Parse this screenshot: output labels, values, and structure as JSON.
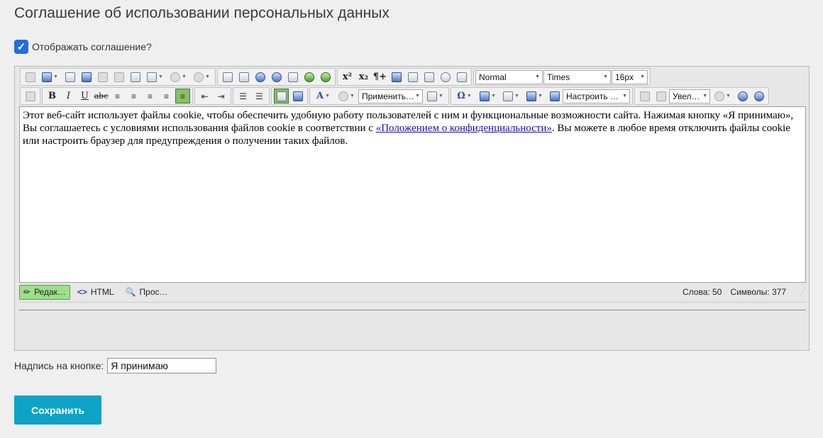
{
  "page": {
    "title": "Соглашение об использовании персональных данных"
  },
  "agreement": {
    "show_label": "Отображать соглашение?",
    "show_checked": true
  },
  "editor": {
    "format_select": "Normal",
    "font_select": "Times",
    "size_select": "16px",
    "apply_select": "Применить…",
    "configure_select": "Настроить …",
    "zoom_select": "Увел…",
    "glyphs": {
      "bold": "B",
      "italic": "I",
      "underline": "U",
      "strike": "abc",
      "omega": "Ω",
      "superscript": "x²",
      "subscript": "x₂",
      "pilcrow": "¶+",
      "font_color": "A"
    },
    "content": {
      "text_before_link": "Этот веб-сайт использует файлы cookie, чтобы обеспечить удобную работу пользователей с ним и функциональные возможности сайта. Нажимая кнопку «Я принимаю», Вы соглашаетесь с условиями использования файлов cookie в соответствии с ",
      "link_text": "«Положением о конфиденциальности»",
      "text_after_link": ". Вы можете в любое время отключить файлы cookie или настроить браузер для предупреждения о получении таких файлов."
    },
    "modes": {
      "edit": "Редак…",
      "html": "HTML",
      "preview": "Прос…"
    },
    "stats": {
      "words": "Слова: 50",
      "chars": "Символы: 377"
    }
  },
  "button_caption": {
    "label": "Надпись на кнопке:",
    "value": "Я принимаю"
  },
  "actions": {
    "save_label": "Сохранить"
  },
  "colors": {
    "accent": "#0ea3c6",
    "checkbox": "#1f6fe0",
    "active_mode": "#9de08a",
    "link": "#1a0dab"
  }
}
